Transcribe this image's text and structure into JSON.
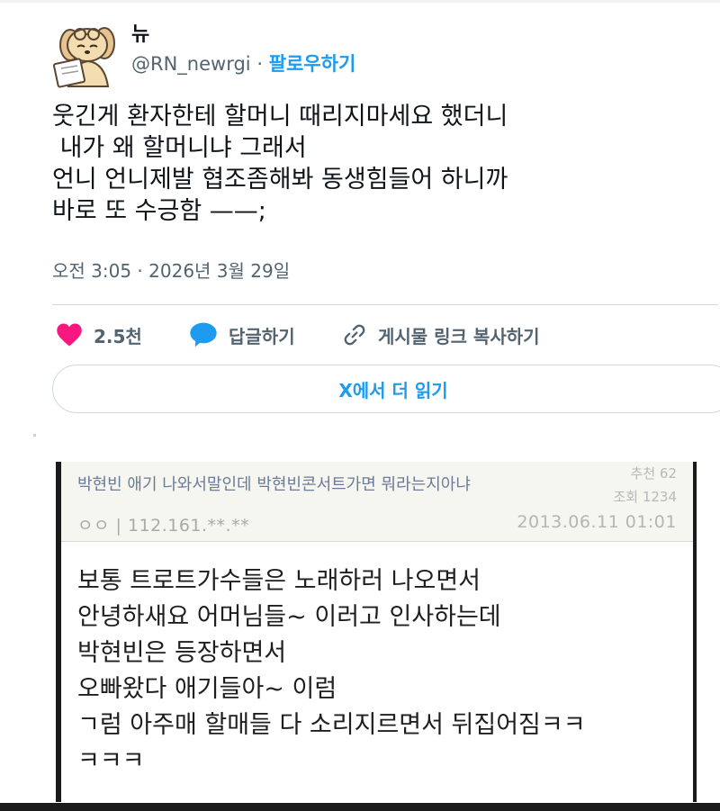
{
  "tweet": {
    "display_name": "뉴",
    "handle": "@RN_newrgi",
    "separator": "·",
    "follow_label": "팔로우하기",
    "body_lines": [
      "웃긴게 환자한테 할머니 때리지마세요 했더니",
      " 내가 왜 할머니냐 그래서",
      "언니 언니제발 협조좀해봐 동생힘들어 하니까",
      "바로 또 수긍함 ——;"
    ],
    "timestamp": "오전 3:05 · 2026년 3월 29일",
    "like_count": "2.5천",
    "reply_label": "답글하기",
    "copy_link_label": "게시물 링크 복사하기",
    "read_more_label": "X에서 더 읽기"
  },
  "embedded_post": {
    "title": "박현빈 애기 나와서말인데 박현빈콘서트가면 뭐라는지아냐",
    "recommend": "추천 62",
    "views": "조회 1234",
    "author": "ㅇㅇ | 112.161.**.**",
    "date": "2013.06.11 01:01",
    "body_lines": [
      "보통 트로트가수들은 노래하러 나오면서",
      "안녕하새요 어머님들~ 이러고 인사하는데",
      "박현빈은 등장하면서",
      "오빠왔다 애기들아~ 이럼",
      "ㄱ럼 아주매 할매들 다 소리지르면서 뒤집어짐ㅋㅋ",
      "ㅋㅋㅋ"
    ]
  },
  "colors": {
    "accent": "#1d9bf0",
    "like": "#f91880",
    "muted": "#536471"
  },
  "icons": [
    "avatar-dog-illustration",
    "heart-icon",
    "speech-bubble-icon",
    "link-icon"
  ]
}
